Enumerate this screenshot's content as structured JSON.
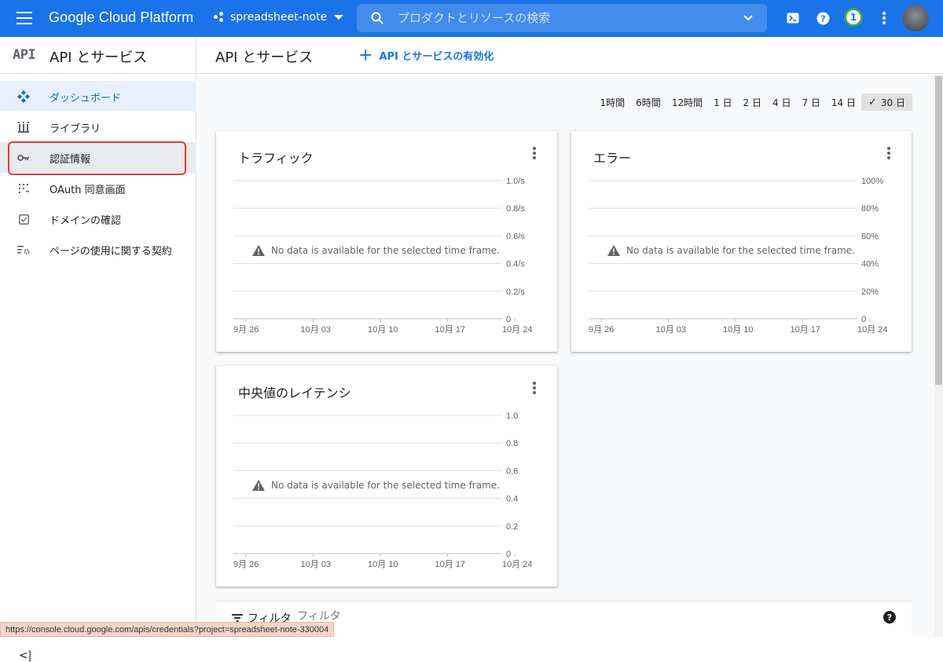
{
  "topbar": {
    "brand": "Google Cloud Platform",
    "project": "spreadsheet-note",
    "search_placeholder": "プロダクトとリソースの検索",
    "notification_count": "1",
    "accent": "#1a73e8"
  },
  "sidebar": {
    "logo": "API",
    "title": "API とサービス",
    "items": [
      {
        "label": "ダッシュボード",
        "icon": "dashboard-icon"
      },
      {
        "label": "ライブラリ",
        "icon": "library-icon"
      },
      {
        "label": "認証情報",
        "icon": "key-icon"
      },
      {
        "label": "OAuth 同意画面",
        "icon": "oauth-consent-icon"
      },
      {
        "label": "ドメインの確認",
        "icon": "checkbox-icon"
      },
      {
        "label": "ページの使用に関する契約",
        "icon": "settings-list-icon"
      }
    ],
    "collapse_label": "<|"
  },
  "main": {
    "title": "API とサービス",
    "enable_label": "API とサービスの有効化",
    "time_tabs": [
      "1時間",
      "6時間",
      "12時間",
      "1 日",
      "2 日",
      "4 日",
      "7 日",
      "14 日",
      "30 日"
    ],
    "selected_tab": "30 日",
    "no_data_message": "No data is available for the selected time frame.",
    "filter_label": "フィルタ",
    "filter_placeholder": "フィルタ"
  },
  "status_url": "https://console.cloud.google.com/apis/credentials?project=spreadsheet-note-330004",
  "chart_data": [
    {
      "type": "line",
      "title": "トラフィック",
      "x_tick_labels": [
        "9月 26",
        "10月 03",
        "10月 10",
        "10月 17",
        "10月 24"
      ],
      "y_tick_labels": [
        "1.0/s",
        "0.8/s",
        "0.6/s",
        "0.4/s",
        "0.2/s",
        "0"
      ],
      "series": [],
      "ylim": [
        0,
        1.0
      ]
    },
    {
      "type": "line",
      "title": "エラー",
      "x_tick_labels": [
        "9月 26",
        "10月 03",
        "10月 10",
        "10月 17",
        "10月 24"
      ],
      "y_tick_labels": [
        "100%",
        "80%",
        "60%",
        "40%",
        "20%",
        "0"
      ],
      "series": [],
      "ylim": [
        0,
        100
      ]
    },
    {
      "type": "line",
      "title": "中央値のレイテンシ",
      "x_tick_labels": [
        "9月 26",
        "10月 03",
        "10月 10",
        "10月 17",
        "10月 24"
      ],
      "y_tick_labels": [
        "1.0",
        "0.8",
        "0.6",
        "0.4",
        "0.2",
        "0"
      ],
      "series": [],
      "ylim": [
        0,
        1.0
      ]
    }
  ]
}
